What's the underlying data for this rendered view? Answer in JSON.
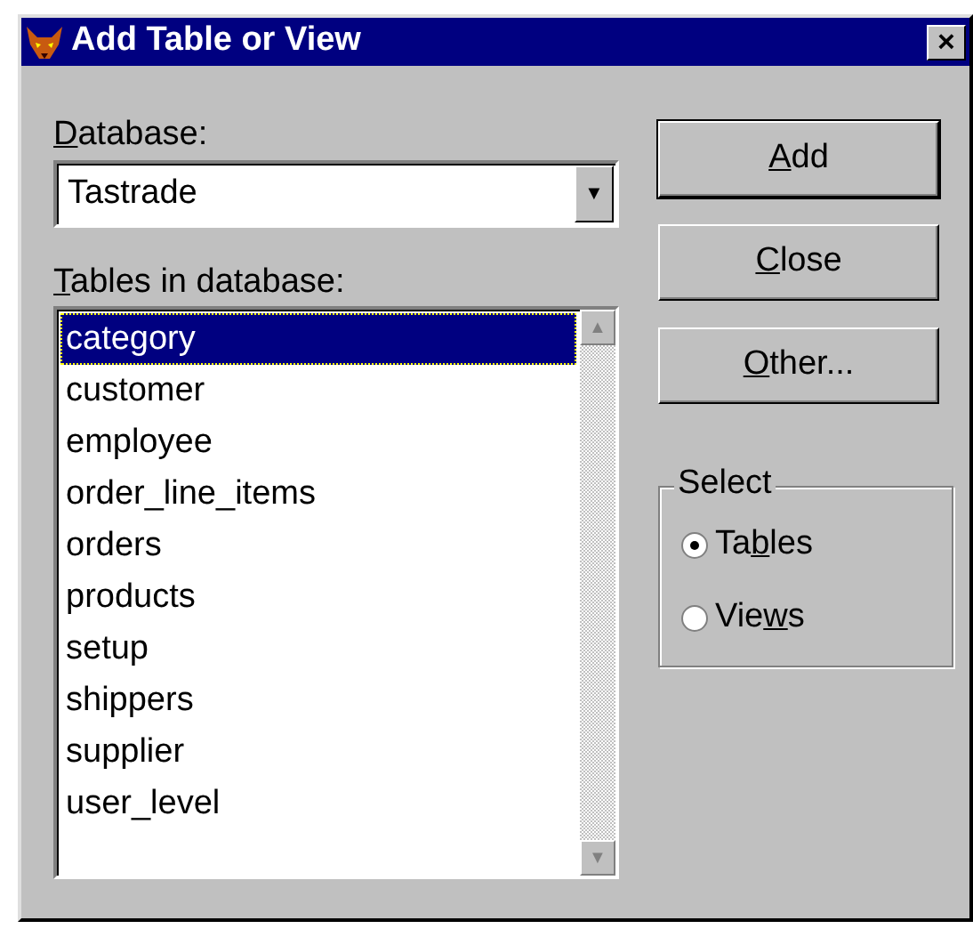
{
  "window": {
    "title": "Add Table or View",
    "close": "×"
  },
  "database": {
    "label": [
      {
        "text": "D",
        "underline": true
      },
      {
        "text": "atabase:",
        "underline": false
      }
    ],
    "value": "Tastrade",
    "arrow": "▼"
  },
  "tables": {
    "label": [
      {
        "text": "T",
        "underline": true
      },
      {
        "text": "ables in database:",
        "underline": false
      }
    ],
    "items": [
      {
        "text": "category",
        "selected": true
      },
      {
        "text": "customer",
        "selected": false
      },
      {
        "text": "employee",
        "selected": false
      },
      {
        "text": "order_line_items",
        "selected": false
      },
      {
        "text": "orders",
        "selected": false
      },
      {
        "text": "products",
        "selected": false
      },
      {
        "text": "setup",
        "selected": false
      },
      {
        "text": "shippers",
        "selected": false
      },
      {
        "text": "supplier",
        "selected": false
      },
      {
        "text": "user_level",
        "selected": false
      }
    ],
    "scroll_up": "▲",
    "scroll_down": "▼"
  },
  "buttons": [
    {
      "label": [
        {
          "text": "A",
          "underline": true
        },
        {
          "text": "dd",
          "underline": false
        }
      ],
      "default": true
    },
    {
      "label": [
        {
          "text": "C",
          "underline": true
        },
        {
          "text": "lose",
          "underline": false
        }
      ],
      "default": false
    },
    {
      "label": [
        {
          "text": "O",
          "underline": true
        },
        {
          "text": "ther...",
          "underline": false
        }
      ],
      "default": false
    }
  ],
  "select": {
    "title": "Select",
    "options": [
      {
        "label": [
          {
            "text": "Ta",
            "underline": false
          },
          {
            "text": "b",
            "underline": true
          },
          {
            "text": "les",
            "underline": false
          }
        ],
        "selected": true
      },
      {
        "label": [
          {
            "text": "Vie",
            "underline": false
          },
          {
            "text": "w",
            "underline": true
          },
          {
            "text": "s",
            "underline": false
          }
        ],
        "selected": false
      }
    ]
  }
}
